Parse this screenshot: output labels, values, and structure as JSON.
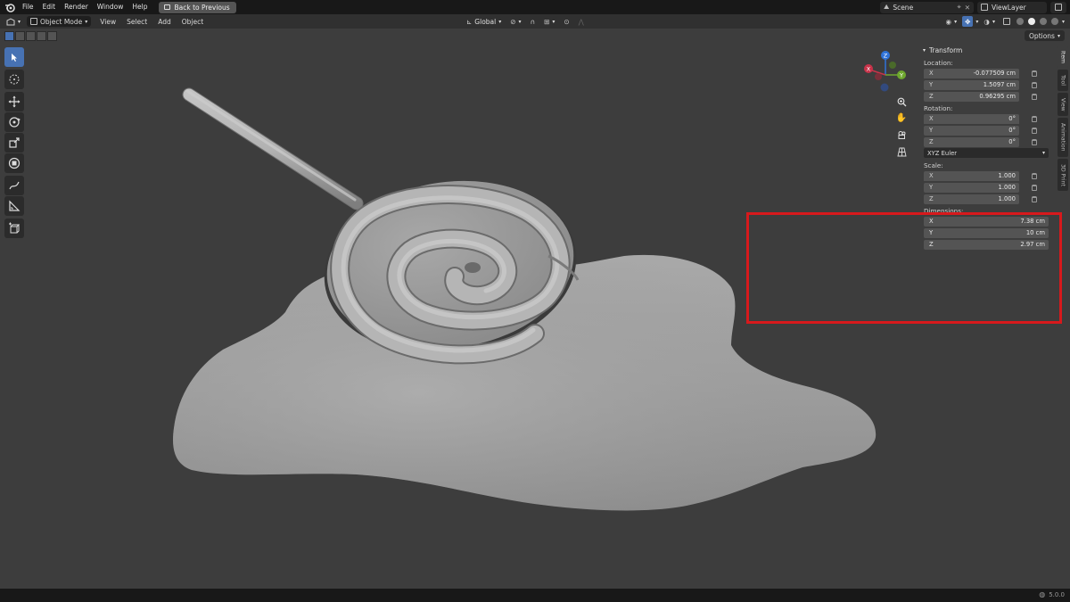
{
  "topbar": {
    "menus": [
      "File",
      "Edit",
      "Render",
      "Window",
      "Help"
    ],
    "back_button": "Back to Previous",
    "scene": "Scene",
    "view_layer": "ViewLayer"
  },
  "header": {
    "mode": "Object Mode",
    "menus": [
      "View",
      "Select",
      "Add",
      "Object"
    ],
    "orientation": "Global",
    "options": "Options"
  },
  "transform": {
    "title": "Transform",
    "location_label": "Location:",
    "location": [
      {
        "axis": "X",
        "value": "-0.077509 cm"
      },
      {
        "axis": "Y",
        "value": "1.5097 cm"
      },
      {
        "axis": "Z",
        "value": "0.96295 cm"
      }
    ],
    "rotation_label": "Rotation:",
    "rotation": [
      {
        "axis": "X",
        "value": "0°"
      },
      {
        "axis": "Y",
        "value": "0°"
      },
      {
        "axis": "Z",
        "value": "0°"
      }
    ],
    "rotation_mode": "XYZ Euler",
    "scale_label": "Scale:",
    "scale": [
      {
        "axis": "X",
        "value": "1.000"
      },
      {
        "axis": "Y",
        "value": "1.000"
      },
      {
        "axis": "Z",
        "value": "1.000"
      }
    ],
    "dimensions_label": "Dimensions:",
    "dimensions": [
      {
        "axis": "X",
        "value": "7.38 cm"
      },
      {
        "axis": "Y",
        "value": "10 cm"
      },
      {
        "axis": "Z",
        "value": "2.97 cm"
      }
    ]
  },
  "side_tabs": [
    "Item",
    "Tool",
    "View",
    "Animation",
    "3D Print"
  ],
  "gizmo": {
    "x": "X",
    "y": "Y",
    "z": "Z"
  },
  "status": {
    "version": "5.0.0"
  },
  "colors": {
    "accent": "#4772b3",
    "annotation": "#d7191c",
    "viewport": "#3d3d3d"
  }
}
